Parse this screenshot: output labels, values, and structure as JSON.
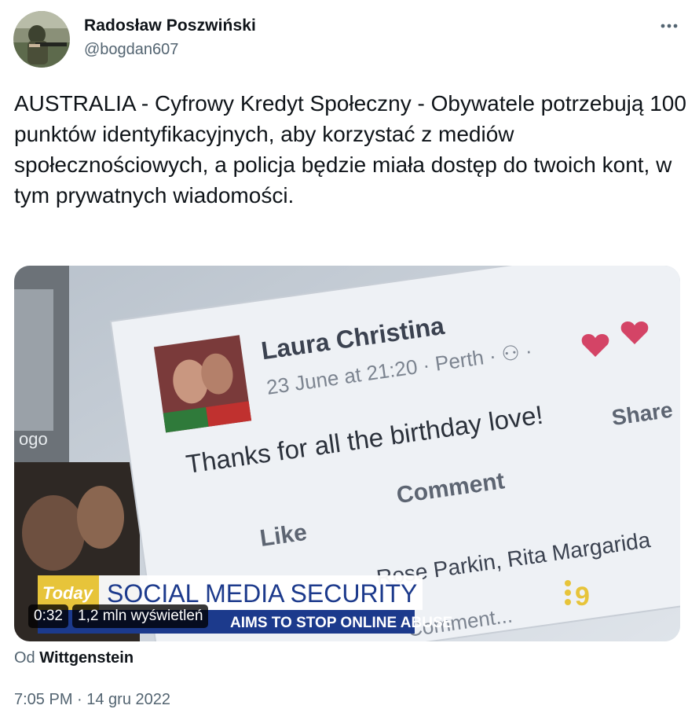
{
  "author": {
    "display_name": "Radosław Poszwiński",
    "handle": "@bogdan607"
  },
  "menu": {
    "more_label": "•••"
  },
  "tweet": {
    "text": "AUSTRALIA - Cyfrowy Kredyt Społeczny - Obywatele potrzebują 100 punktów identyfikacyjnych, aby korzystać z mediów społecznościowych, a policja będzie miała dostęp do twoich kont, w tym prywatnych wiadomości.",
    "timestamp": "7:05 PM · 14 gru 2022"
  },
  "media": {
    "duration": "0:32",
    "views": "1,2 mln wyświetleń",
    "post_name": "Laura Christina",
    "post_meta": "23 June at 21:20 · Perth · ⚇ ·",
    "post_text": "Thanks for all the birthday love!",
    "share_label": "Share",
    "comment_label": "Comment",
    "like_label": "Like",
    "names_label": "Rose Parkin, Rita Margarida",
    "comment_prompt": "Comment...",
    "left_label": "ogo",
    "banner_brand": "Today",
    "banner_title": "SOCIAL MEDIA SECURITY",
    "ticker": "AIMS TO STOP ONLINE ABUSE",
    "channel_logo": "9"
  },
  "attribution": {
    "prefix": "Od",
    "source": "Wittgenstein"
  },
  "colors": {
    "text_primary": "#0f1419",
    "text_secondary": "#536471",
    "banner_blue": "#1c3a8c",
    "banner_gold": "#e7c43a"
  }
}
